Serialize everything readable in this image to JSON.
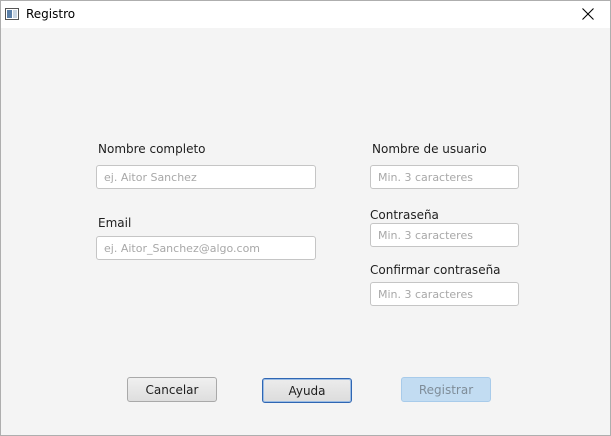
{
  "window": {
    "title": "Registro",
    "icon": "app-window-icon",
    "close_icon": "close-icon"
  },
  "form": {
    "full_name": {
      "label": "Nombre completo",
      "value": "",
      "placeholder": "ej. Aitor Sanchez"
    },
    "email": {
      "label": "Email",
      "value": "",
      "placeholder": "ej. Aitor_Sanchez@algo.com"
    },
    "username": {
      "label": "Nombre de usuario",
      "value": "",
      "placeholder": "Min. 3 caracteres"
    },
    "password": {
      "label": "Contraseña",
      "value": "",
      "placeholder": "Min. 3 caracteres"
    },
    "confirm_password": {
      "label": "Confirmar contraseña",
      "value": "",
      "placeholder": "Min. 3 caracteres"
    }
  },
  "buttons": {
    "cancel": "Cancelar",
    "help": "Ayuda",
    "register": "Registrar"
  },
  "colors": {
    "window_bg": "#f4f4f4",
    "focus_border": "#2f66b3",
    "disabled_button_bg": "#c2dcf2"
  }
}
